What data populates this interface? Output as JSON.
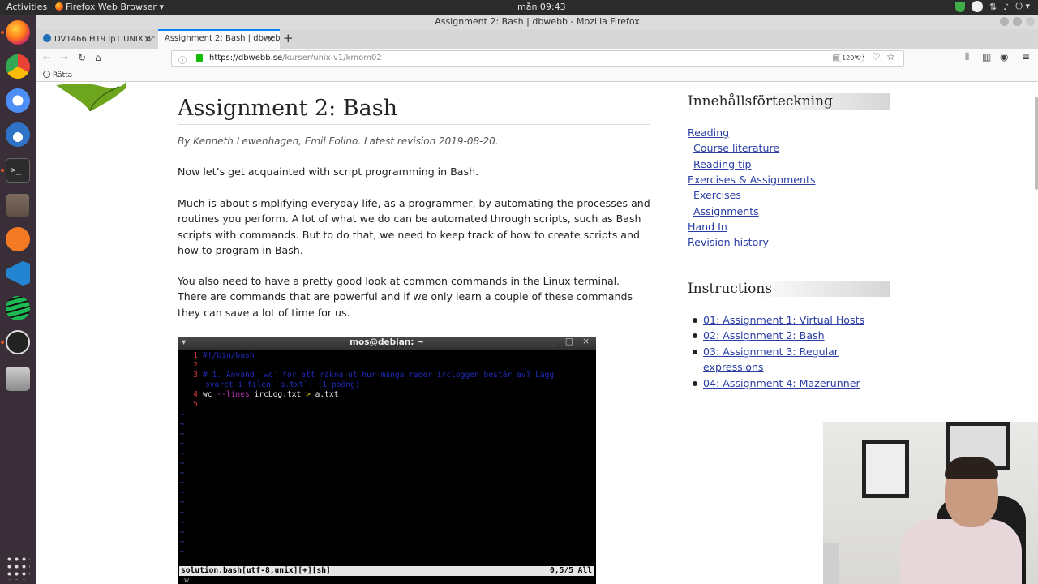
{
  "gnome": {
    "activities": "Activities",
    "app_menu": "Firefox Web Browser ▾",
    "clock": "mån 09:43",
    "tray_volume": "♪",
    "tray_network": "⇅",
    "tray_power": "⏻ ▾"
  },
  "browser": {
    "window_title": "Assignment 2: Bash | dbwebb - Mozilla Firefox",
    "tabs": [
      {
        "label": "DV1466 H19 lp1 UNIX oc"
      },
      {
        "label": "Assignment 2: Bash | dbweb"
      }
    ],
    "new_tab": "+",
    "tab_close": "×",
    "url_host": "https://dbwebb.se",
    "url_path": "/kurser/unix-v1/kmom02",
    "zoom": "120%",
    "bookmark": "Rätta"
  },
  "article": {
    "title": "Assignment 2: Bash",
    "byline": "By Kenneth Lewenhagen, Emil Folino. Latest revision 2019-08-20.",
    "p1": "Now let’s get acquainted with script programming in Bash.",
    "p2": "Much is about simplifying everyday life, as a programmer, by automating the processes and routines you perform. A lot of what we do can be automated through scripts, such as Bash scripts with commands. But to do that, we need to keep track of how to create scripts and how to program in Bash.",
    "p3": "You also need to have a pretty good look at common commands in the Linux terminal. There are commands that are powerful and if we only learn a couple of these commands they can save a lot of time for us."
  },
  "terminal": {
    "title": "mos@debian: ~",
    "controls": "_ □ ×",
    "menu": "▾",
    "lines": [
      {
        "n": "1",
        "comment": "#!/bin/bash"
      },
      {
        "n": "2",
        "comment": ""
      },
      {
        "n": "3",
        "comment": "# 1. Använd `wc` för att räkna ut hur många rader ircloggen består av? Lägg"
      },
      {
        "n": "",
        "comment": "svaret i filen `a.txt`. (1 poäng)"
      },
      {
        "n": "4",
        "code": true,
        "cmd": "wc ",
        "opt": "--lines",
        "arg": " ircLog.txt ",
        "op": ">",
        "tail": " a.txt"
      },
      {
        "n": "5",
        "comment": ""
      }
    ],
    "tilde_count": 15,
    "status_left": "solution.bash[utf-8,unix][+][sh]",
    "status_right": "0,5/5 All",
    "cmdline": ":w"
  },
  "sidebar": {
    "toc_title": "Innehållsförteckning",
    "toc": [
      {
        "label": "Reading",
        "indent": 0
      },
      {
        "label": "Course literature",
        "indent": 1
      },
      {
        "label": "Reading tip",
        "indent": 1
      },
      {
        "label": "Exercises & Assignments",
        "indent": 0
      },
      {
        "label": "Exercises",
        "indent": 1
      },
      {
        "label": "Assignments",
        "indent": 1
      },
      {
        "label": "Hand In",
        "indent": 0
      },
      {
        "label": "Revision history",
        "indent": 0
      }
    ],
    "instructions_title": "Instructions",
    "instructions": [
      "01: Assignment 1: Virtual Hosts",
      "02: Assignment 2: Bash",
      "03: Assignment 3: Regular expressions",
      "04: Assignment 4: Mazerunner"
    ]
  },
  "colors": {
    "link": "#2a3ea6",
    "dock_bg": "#3a2f38",
    "topbar_bg": "#2b2b2b",
    "tab_active_accent": "#0a84ff"
  }
}
